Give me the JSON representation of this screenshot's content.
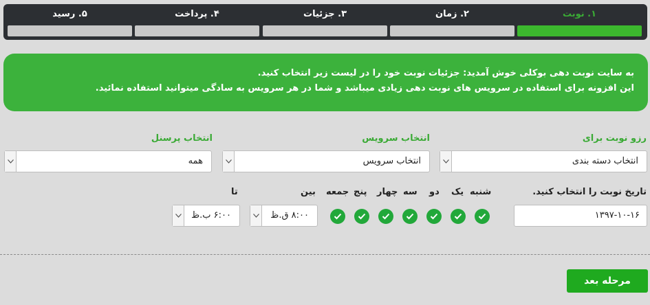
{
  "steps": [
    {
      "label": "۱. نوبت",
      "active": true
    },
    {
      "label": "۲. زمان",
      "active": false
    },
    {
      "label": "۳. جزئیات",
      "active": false
    },
    {
      "label": "۴. پرداخت",
      "active": false
    },
    {
      "label": "۵. رسید",
      "active": false
    }
  ],
  "welcome": {
    "line1": "به سایت نوبت دهی بوکلی خوش آمدید: جزئیات نوبت خود را در لیست زیر انتخاب کنید.",
    "line2": "این افزونه برای استفاده در سرویس های نوبت دهی زیادی میباشد و شما در هر سرویس به سادگی میتوانید استفاده نمائید."
  },
  "fields": {
    "category": {
      "label": "رزو نوبت برای",
      "value": "انتخاب دسته بندی"
    },
    "service": {
      "label": "انتخاب سرویس",
      "value": "انتخاب سرویس"
    },
    "staff": {
      "label": "انتخاب پرسنل",
      "value": "همه"
    }
  },
  "date": {
    "label": "تاریخ نوبت را انتخاب کنید.",
    "value": "۱۳۹۷-۱۰-۱۶"
  },
  "days": [
    {
      "label": "شنبه",
      "checked": true
    },
    {
      "label": "یک",
      "checked": true
    },
    {
      "label": "دو",
      "checked": true
    },
    {
      "label": "سه",
      "checked": true
    },
    {
      "label": "چهار",
      "checked": true
    },
    {
      "label": "پنج",
      "checked": true
    },
    {
      "label": "جمعه",
      "checked": true
    }
  ],
  "time": {
    "between_label": "بین",
    "from_value": "۸:۰۰ ق.ظ",
    "to_label": "تا",
    "to_value": "۶:۰۰ ب.ظ"
  },
  "next_button": "مرحله بعد",
  "colors": {
    "accent": "#3cb82e",
    "welcome_bg": "#3cb23c",
    "steps_bg": "#2c2f33",
    "page_bg": "#dcdcdc"
  }
}
